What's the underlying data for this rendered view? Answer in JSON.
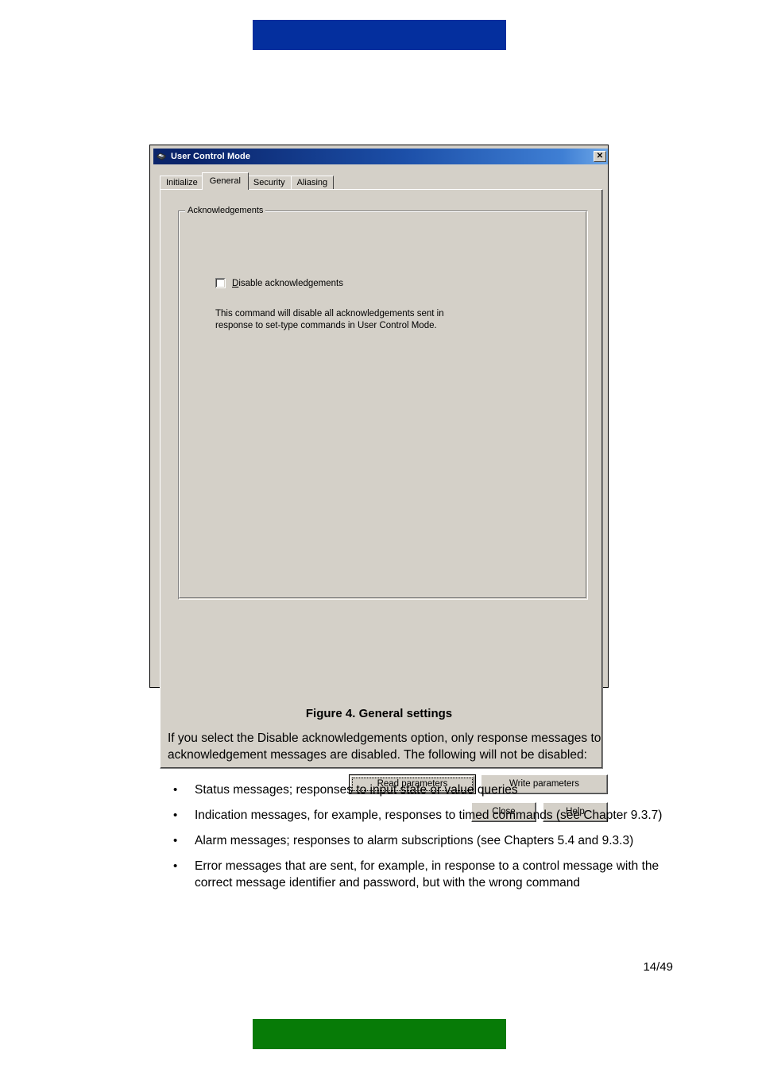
{
  "page": {
    "top_bar_color": "#042f9e",
    "bottom_bar_color": "#077b07",
    "page_number": "14/49"
  },
  "dialog": {
    "title": "User Control Mode",
    "title_icon": "device-network-icon",
    "close_label": "✕",
    "background_color": "#d4d0c8",
    "titlebar_color": "#0a246a",
    "tabs": [
      {
        "label": "Initialize",
        "selected": false
      },
      {
        "label": "General",
        "selected": true
      },
      {
        "label": "Security",
        "selected": false
      },
      {
        "label": "Aliasing",
        "selected": false
      }
    ],
    "groupbox": {
      "legend": "Acknowledgements",
      "checkbox": {
        "label_accel": "D",
        "label_rest": "isable acknowledgements",
        "checked": false
      },
      "description_line1": "This command will disable all acknowledgements sent in",
      "description_line2": "response to set-type commands in User Control Mode."
    },
    "buttons": {
      "read_parameters": "Read parameters",
      "write_parameters": "Write parameters",
      "close": "Close",
      "help": "Help"
    }
  },
  "document": {
    "figure_caption": "Figure 4. General settings",
    "intro_paragraph": "If you select the Disable acknowledgements option, only response messages to acknowledgement messages are disabled. The following will not be disabled:",
    "bullets": [
      "Status messages; responses to input state or value queries",
      "Indication messages, for example, responses to timed commands (see Chapter 9.3.7)",
      "Alarm messages; responses to alarm subscriptions (see Chapters 5.4 and 9.3.3)",
      "Error messages that are sent, for example, in response to a control message with the correct message identifier and password, but with the wrong command"
    ],
    "bullet_glyph": "•"
  }
}
